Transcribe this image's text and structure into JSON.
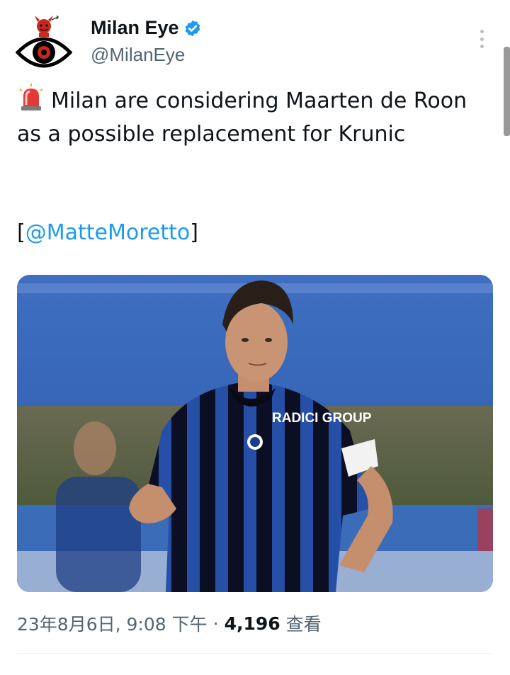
{
  "author": {
    "display_name": "Milan Eye",
    "handle": "@MilanEye",
    "verified": true,
    "avatar_icon": "devil-eye-logo"
  },
  "tweet": {
    "emoji": "police-siren-icon",
    "text": "Milan are considering Maarten de Roon as a possible replacement for Krunic",
    "source_open": "[",
    "source_mention": "@MatteMoretto",
    "source_close": "]"
  },
  "media": {
    "jersey_sponsor": "RADICI GROUP"
  },
  "meta": {
    "timestamp": "23年8月6日, 9:08 下午",
    "separator": "·",
    "views_count": "4,196",
    "views_label": "查看"
  },
  "colors": {
    "accent": "#1d9bf0",
    "secondary_text": "#536471",
    "primary_text": "#0f1419"
  }
}
